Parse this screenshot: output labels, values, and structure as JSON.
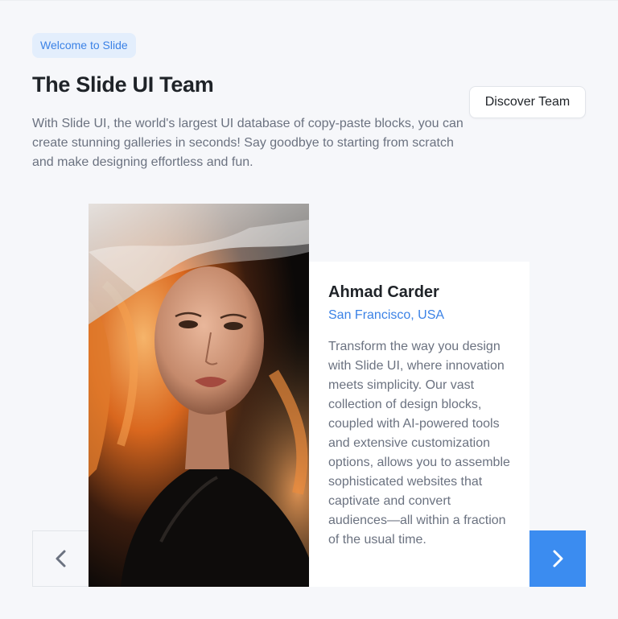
{
  "header": {
    "badge": "Welcome to Slide",
    "title": "The Slide UI Team",
    "description": "With Slide UI, the world's largest UI database of copy-paste blocks, you can create stunning galleries in seconds! Say goodbye to starting from scratch and make designing effortless and fun.",
    "discover_button": "Discover Team"
  },
  "member": {
    "name": "Ahmad Carder",
    "location": "San Francisco, USA",
    "bio": "Transform the way you design with Slide UI, where innovation meets simplicity. Our vast collection of design blocks, coupled with AI-powered tools and extensive customization options, allows you to assemble sophisticated websites that captivate and convert audiences—all within a fraction of the usual time.",
    "photo_alt": "Portrait photo"
  },
  "navigation": {
    "prev_icon": "chevron-left-icon",
    "next_icon": "chevron-right-icon"
  },
  "colors": {
    "accent": "#3b8cf0",
    "badge_bg": "#e3eefc",
    "background": "#f6f7fa"
  }
}
